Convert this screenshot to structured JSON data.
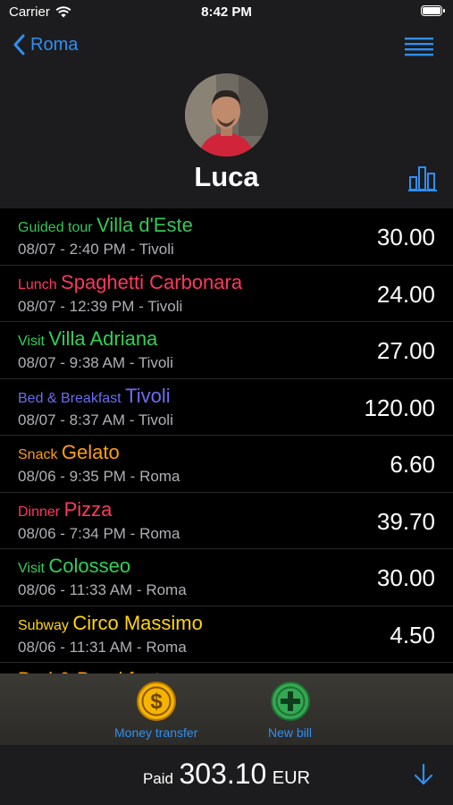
{
  "status_bar": {
    "carrier": "Carrier",
    "time": "8:42 PM"
  },
  "nav": {
    "back_label": "Roma"
  },
  "profile": {
    "name": "Luca"
  },
  "colors": {
    "accent": "#2f8ff7",
    "tour": "#35c759",
    "lunch": "#ff375f",
    "visit": "#30d158",
    "bnb": "#5e5ce6",
    "snack": "#ff9f0a",
    "dinner": "#ff375f",
    "subway": "#ffd60a"
  },
  "expenses": [
    {
      "category": "Guided tour",
      "place": "Villa d'Este",
      "meta": "08/07 - 2:40 PM - Tivoli",
      "amount": "30.00",
      "color": "#35c759"
    },
    {
      "category": "Lunch",
      "place": "Spaghetti Carbonara",
      "meta": "08/07 - 12:39 PM - Tivoli",
      "amount": "24.00",
      "color": "#ff375f"
    },
    {
      "category": "Visit",
      "place": "Villa Adriana",
      "meta": "08/07 - 9:38 AM - Tivoli",
      "amount": "27.00",
      "color": "#30d158"
    },
    {
      "category": "Bed & Breakfast",
      "place": "Tivoli",
      "meta": "08/07 - 8:37 AM - Tivoli",
      "amount": "120.00",
      "color": "#6e6cf0"
    },
    {
      "category": "Snack",
      "place": "Gelato",
      "meta": "08/06 - 9:35 PM - Roma",
      "amount": "6.60",
      "color": "#ff9f0a"
    },
    {
      "category": "Dinner",
      "place": "Pizza",
      "meta": "08/06 - 7:34 PM - Roma",
      "amount": "39.70",
      "color": "#ff375f"
    },
    {
      "category": "Visit",
      "place": "Colosseo",
      "meta": "08/06 - 11:33 AM - Roma",
      "amount": "30.00",
      "color": "#30d158"
    },
    {
      "category": "Subway",
      "place": "Circo Massimo",
      "meta": "08/06 - 11:31 AM - Roma",
      "amount": "4.50",
      "color": "#ffd60a"
    },
    {
      "category": "",
      "place": "Bed & Breakfast",
      "meta": "",
      "amount": "",
      "color": "#ff9f0a"
    }
  ],
  "toolbar": {
    "money_transfer_label": "Money transfer",
    "new_bill_label": "New bill"
  },
  "footer": {
    "paid_label": "Paid",
    "paid_amount": "303.10",
    "currency": "EUR"
  }
}
